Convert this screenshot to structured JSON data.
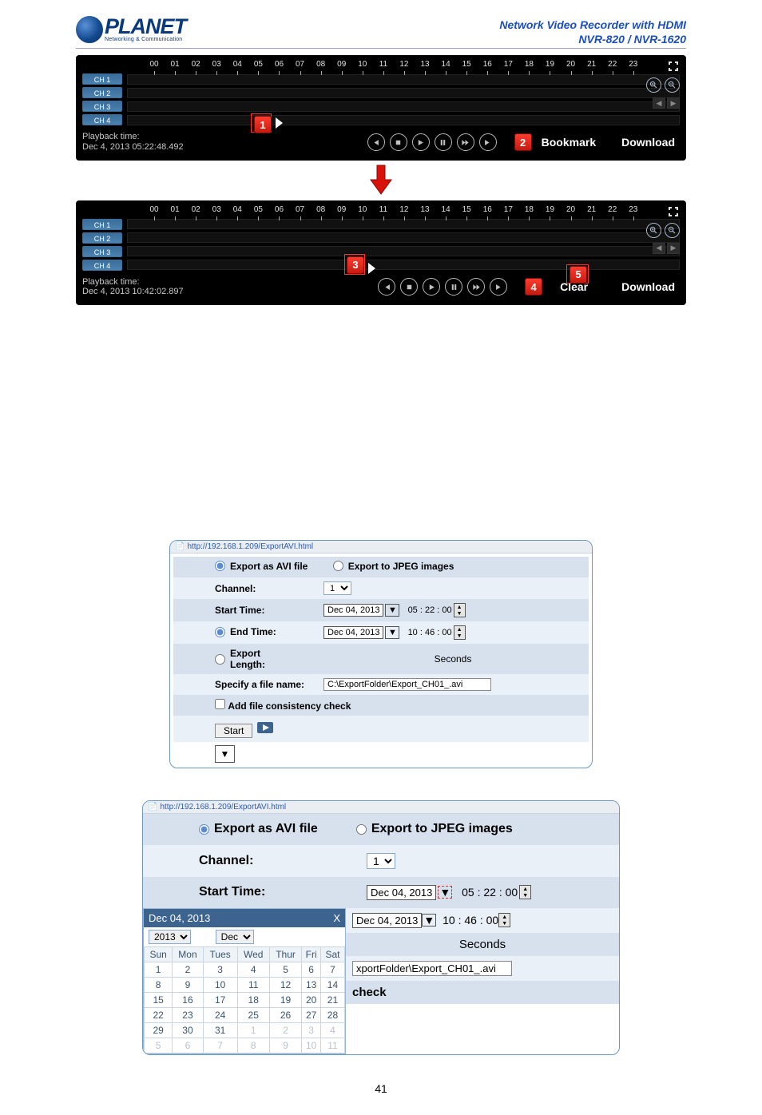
{
  "header": {
    "brand_main": "PLANET",
    "brand_sub": "Networking & Communication",
    "title_line1": "Network Video Recorder with HDMI",
    "title_line2": "NVR-820 / NVR-1620"
  },
  "hours": [
    "00",
    "01",
    "02",
    "03",
    "04",
    "05",
    "06",
    "07",
    "08",
    "09",
    "10",
    "11",
    "12",
    "13",
    "14",
    "15",
    "16",
    "17",
    "18",
    "19",
    "20",
    "21",
    "22",
    "23"
  ],
  "panel1": {
    "channels": [
      "CH 1",
      "CH 2",
      "CH 3",
      "CH 4"
    ],
    "playback_label": "Playback time:",
    "playback_value": "Dec 4, 2013 05:22:48.492",
    "badge1": "1",
    "badge2": "2",
    "btn_bookmark": "Bookmark",
    "btn_download": "Download"
  },
  "panel2": {
    "channels": [
      "CH 1",
      "CH 2",
      "CH 3",
      "CH 4"
    ],
    "playback_label": "Playback time:",
    "playback_value": "Dec 4, 2013 10:42:02.897",
    "badge3": "3",
    "badge4": "4",
    "badge5": "5",
    "btn_clear": "Clear",
    "btn_download": "Download"
  },
  "dialog1": {
    "url": "http://192.168.1.209/ExportAVI.html",
    "opt_avi": "Export as AVI file",
    "opt_jpeg": "Export to JPEG images",
    "channel_label": "Channel:",
    "channel_value": "1",
    "start_label": "Start Time:",
    "start_date": "Dec 04, 2013",
    "start_time": "05 : 22 : 00",
    "end_label": "End Time:",
    "end_date": "Dec 04, 2013",
    "end_time": "10 : 46 : 00",
    "length_label": "Export Length:",
    "length_unit": "Seconds",
    "filename_label": "Specify a file name:",
    "filename_value": "C:\\ExportFolder\\Export_CH01_.avi",
    "check_label": "Add file consistency check",
    "start_btn": "Start"
  },
  "dialog2": {
    "url": "http://192.168.1.209/ExportAVI.html",
    "opt_avi": "Export as AVI file",
    "opt_jpeg": "Export to JPEG images",
    "channel_label": "Channel:",
    "channel_value": "1",
    "start_label": "Start Time:",
    "start_date": "Dec 04, 2013",
    "start_time": "05 : 22 : 00",
    "end_date": "Dec 04, 2013",
    "end_time": "10 : 46 : 00",
    "length_unit": "Seconds",
    "filename_tail": "xportFolder\\Export_CH01_.avi",
    "check_tail": "check",
    "cal_title": "Dec 04, 2013",
    "cal_year": "2013",
    "cal_month": "Dec",
    "cal_close": "X",
    "dow": [
      "Sun",
      "Mon",
      "Tues",
      "Wed",
      "Thur",
      "Fri",
      "Sat"
    ],
    "weeks": [
      [
        "1",
        "2",
        "3",
        "4",
        "5",
        "6",
        "7"
      ],
      [
        "8",
        "9",
        "10",
        "11",
        "12",
        "13",
        "14"
      ],
      [
        "15",
        "16",
        "17",
        "18",
        "19",
        "20",
        "21"
      ],
      [
        "22",
        "23",
        "24",
        "25",
        "26",
        "27",
        "28"
      ],
      [
        "29",
        "30",
        "31",
        "1",
        "2",
        "3",
        "4"
      ],
      [
        "5",
        "6",
        "7",
        "8",
        "9",
        "10",
        "11"
      ]
    ]
  },
  "footer": "41"
}
